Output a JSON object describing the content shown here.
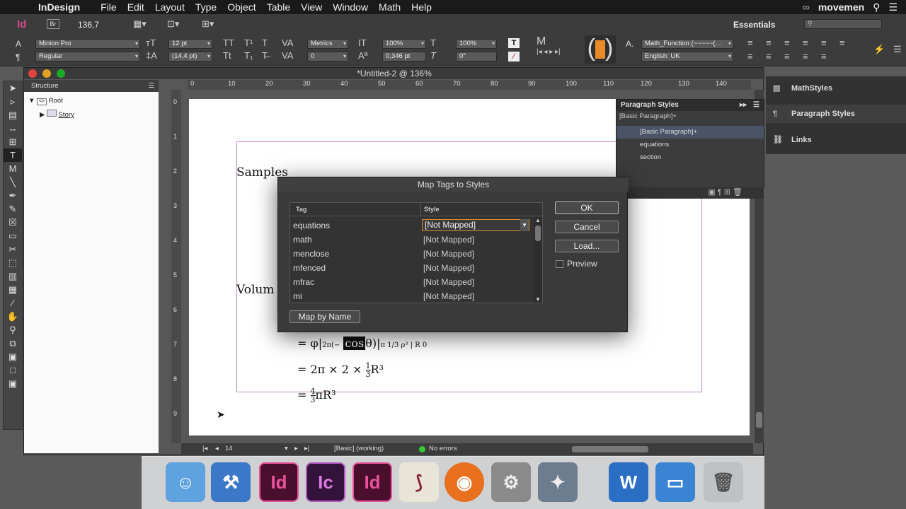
{
  "menubar": {
    "app": "InDesign",
    "items": [
      "File",
      "Edit",
      "Layout",
      "Type",
      "Object",
      "Table",
      "View",
      "Window",
      "Math",
      "Help"
    ],
    "user": "movemen"
  },
  "control": {
    "zoom": "136,7",
    "font": "Minion Pro",
    "style": "Regular",
    "size": "12 pt",
    "leading": "(14,4 pt)",
    "kerning": "Metrics",
    "tracking": "0",
    "vscale": "100%",
    "hscale": "100%",
    "baseline": "0,346 pt",
    "skew": "0°",
    "char_style": "Math_Function (~~~~~(...",
    "language": "English: UK",
    "workspace": "Essentials"
  },
  "document": {
    "title": "*Untitled-2 @ 136%",
    "ruler_labels": [
      "0",
      "10",
      "20",
      "30",
      "40",
      "50",
      "60",
      "70",
      "80",
      "90",
      "100",
      "110",
      "120",
      "130",
      "140"
    ],
    "vruler_labels": [
      "0",
      "1",
      "2",
      "3",
      "4",
      "5",
      "6",
      "7",
      "8",
      "9"
    ],
    "heading1": "Samples",
    "heading2": "Volum",
    "eq1_prefix": "= φ|",
    "eq1_cos": "cos",
    "eq1_rest": "θ)|",
    "eq2": "= 2π × 2 ×",
    "eq2_tail": "R³",
    "eq3_tail": "πR³",
    "frac_num": "1",
    "frac_den": "3",
    "frac4_num": "4",
    "frac4_den": "3",
    "page_num": "14",
    "profile": "[Basic] (working)",
    "preflight": "No errors"
  },
  "structure": {
    "header": "Structure",
    "root": "Root",
    "story": "Story"
  },
  "paragraph_styles": {
    "title": "Paragraph Styles",
    "current": "[Basic Paragraph]+",
    "items": [
      "[Basic Paragraph]+",
      "equations",
      "section"
    ]
  },
  "right_panel": {
    "items": [
      "MathStyles",
      "Paragraph Styles",
      "Links"
    ]
  },
  "dialog": {
    "title": "Map Tags to Styles",
    "col_tag": "Tag",
    "col_style": "Style",
    "rows": [
      {
        "tag": "equations",
        "style": "[Not Mapped]"
      },
      {
        "tag": "math",
        "style": "[Not Mapped]"
      },
      {
        "tag": "menclose",
        "style": "[Not Mapped]"
      },
      {
        "tag": "mfenced",
        "style": "[Not Mapped]"
      },
      {
        "tag": "mfrac",
        "style": "[Not Mapped]"
      },
      {
        "tag": "mi",
        "style": "[Not Mapped]"
      }
    ],
    "ok": "OK",
    "cancel": "Cancel",
    "load": "Load...",
    "preview": "Preview",
    "map_by_name": "Map by Name"
  },
  "dock": {
    "apps": [
      {
        "label": "Finder",
        "icon": "finder-icon",
        "color": "#5fa2e0"
      },
      {
        "label": "Xcode",
        "icon": "xcode-icon",
        "color": "#3c78c8"
      },
      {
        "label": "Id",
        "icon": "indesign-icon",
        "color": "#4b0f2e"
      },
      {
        "label": "Ic",
        "icon": "incopy-icon",
        "color": "#33123b"
      },
      {
        "label": "Id",
        "icon": "indesign-icon-2",
        "color": "#4b0f2e"
      },
      {
        "label": "Script",
        "icon": "script-icon",
        "color": "#e9e4d8"
      },
      {
        "label": "Firefox",
        "icon": "firefox-icon",
        "color": "#e8701e"
      },
      {
        "label": "Prefs",
        "icon": "gear-icon",
        "color": "#8a8a8a"
      },
      {
        "label": "iMovie",
        "icon": "imovie-icon",
        "color": "#6b7d8f"
      },
      {
        "label": "W",
        "icon": "word-icon",
        "color": "#2b6fc4"
      },
      {
        "label": "Keynote",
        "icon": "keynote-icon",
        "color": "#3a84d4"
      },
      {
        "label": "Trash",
        "icon": "trash-icon",
        "color": "#bfc2c5"
      }
    ]
  }
}
